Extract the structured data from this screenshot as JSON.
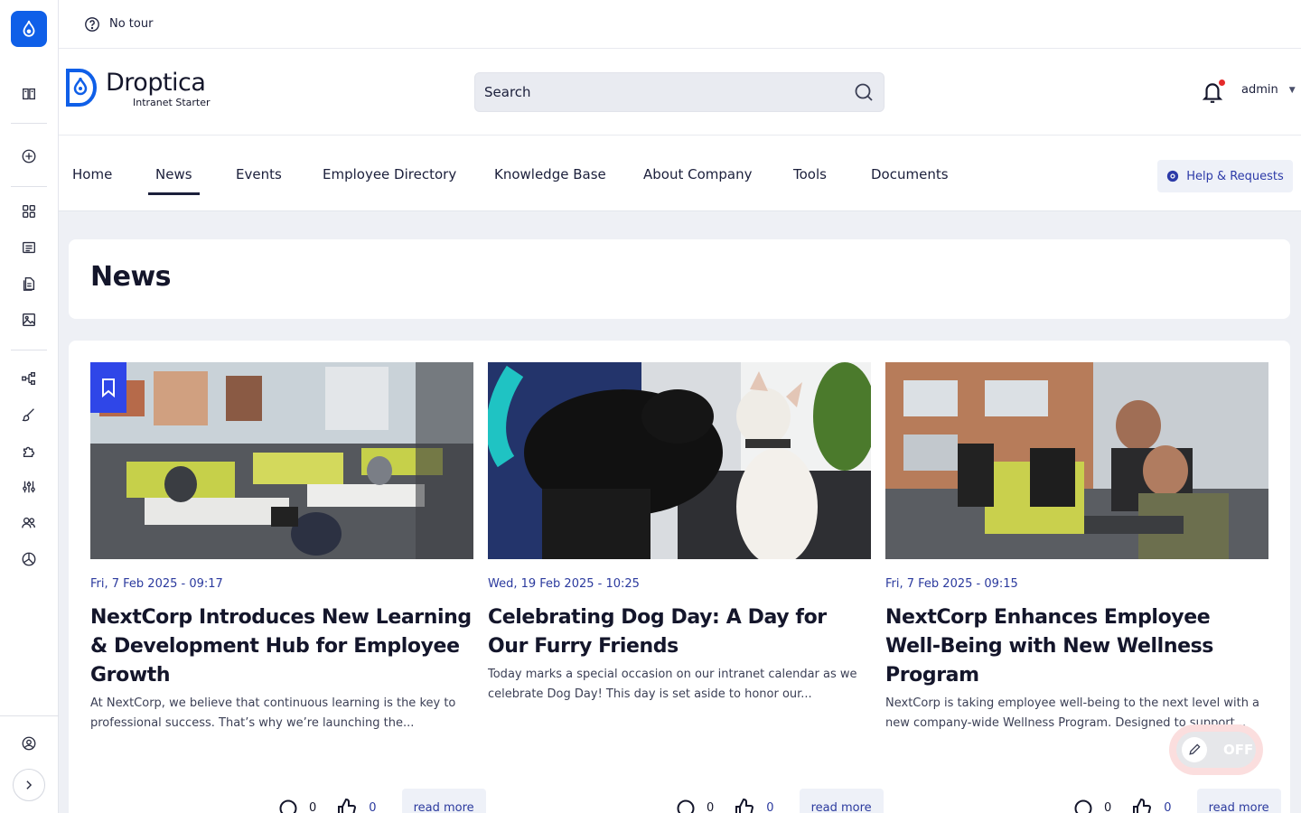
{
  "tour": {
    "label": "No tour"
  },
  "brand": {
    "name": "Droptica",
    "subtitle": "Intranet Starter"
  },
  "search": {
    "placeholder": "Search"
  },
  "user": {
    "name": "admin"
  },
  "nav": {
    "items": [
      {
        "label": "Home"
      },
      {
        "label": "News",
        "active": true
      },
      {
        "label": "Events"
      },
      {
        "label": "Employee Directory"
      },
      {
        "label": "Knowledge Base"
      },
      {
        "label": "About Company"
      },
      {
        "label": "Tools"
      },
      {
        "label": "Documents"
      }
    ],
    "help_label": "Help & Requests"
  },
  "page": {
    "title": "News"
  },
  "cards": [
    {
      "date": "Fri, 7 Feb 2025 - 09:17",
      "title": "NextCorp Introduces New Learning & Development Hub for Employee Growth",
      "excerpt": "At NextCorp, we believe that continuous learning is the key to professional success. That’s why we’re launching the...",
      "comments": "0",
      "likes": "0",
      "read_more": "read more",
      "bookmarked": true
    },
    {
      "date": "Wed, 19 Feb 2025 - 10:25",
      "title": "Celebrating Dog Day: A Day for Our Furry Friends",
      "excerpt": "Today marks a special occasion on our intranet calendar as we celebrate Dog Day! This day is set aside to honor our...",
      "comments": "0",
      "likes": "0",
      "read_more": "read more"
    },
    {
      "date": "Fri, 7 Feb 2025 - 09:15",
      "title": "NextCorp Enhances Employee Well-Being with New Wellness Program",
      "excerpt": "NextCorp is taking employee well-being to the next level with a new company-wide Wellness Program. Designed to support...",
      "comments": "0",
      "likes": "0",
      "read_more": "read more"
    }
  ],
  "edit_mode": {
    "label": "OFF"
  },
  "colors": {
    "accent": "#0f5fe8",
    "link": "#2b3a9e",
    "bookmark": "#2f46e8"
  }
}
